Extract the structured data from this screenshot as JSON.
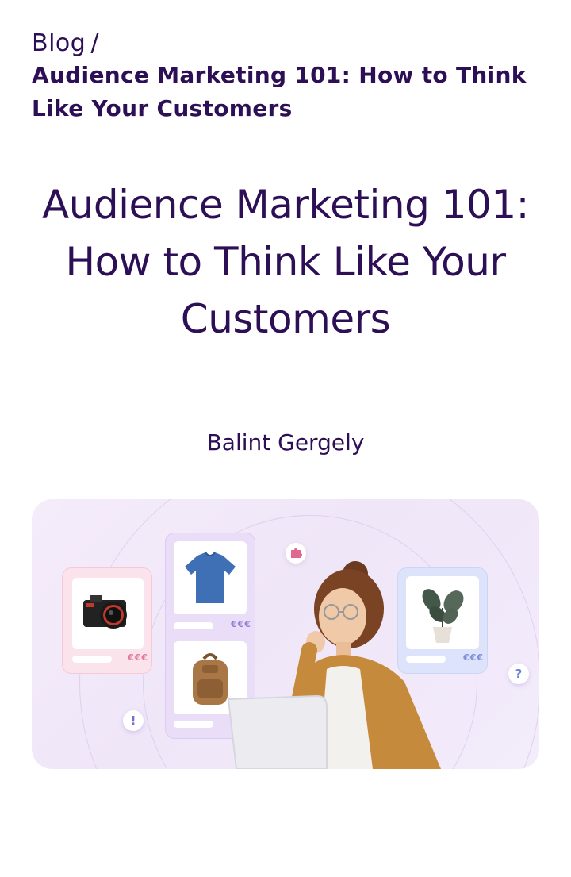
{
  "breadcrumb": {
    "blog_label": "Blog",
    "separator": "/",
    "current": "Audience Marketing 101: How to Think Like Your Customers"
  },
  "article": {
    "title": "Audience Marketing 101: How to Think Like Your Customers",
    "author": "Balint Gergely"
  },
  "hero": {
    "price_symbol": "€€€",
    "exclamation": "!",
    "question": "?",
    "icons": [
      "camera-icon",
      "tshirt-icon",
      "backpack-icon",
      "plant-icon",
      "puzzle-icon"
    ]
  },
  "colors": {
    "text": "#2d0f55",
    "hero_bg": "#f1e8f9",
    "card_pink": "#fbe3ec",
    "card_lilac": "#e9ddf8",
    "card_blue": "#dde3fb"
  }
}
